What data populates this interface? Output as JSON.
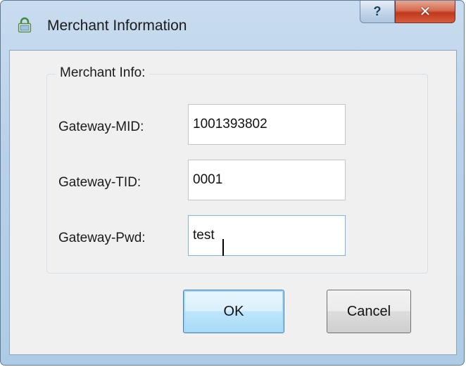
{
  "window": {
    "title": "Merchant Information",
    "help_label": "?",
    "close_label": "✕",
    "icon": "lock-icon"
  },
  "group": {
    "legend": "Merchant Info:"
  },
  "fields": [
    {
      "label": "Gateway-MID:",
      "value": "1001393802"
    },
    {
      "label": "Gateway-TID:",
      "value": "0001"
    },
    {
      "label": "Gateway-Pwd:",
      "value": "test"
    }
  ],
  "buttons": {
    "ok": "OK",
    "cancel": "Cancel"
  },
  "colors": {
    "close_button": "#c0391c",
    "default_button_border": "#3c7fb1",
    "focused_input_border": "#7eb4ea"
  }
}
